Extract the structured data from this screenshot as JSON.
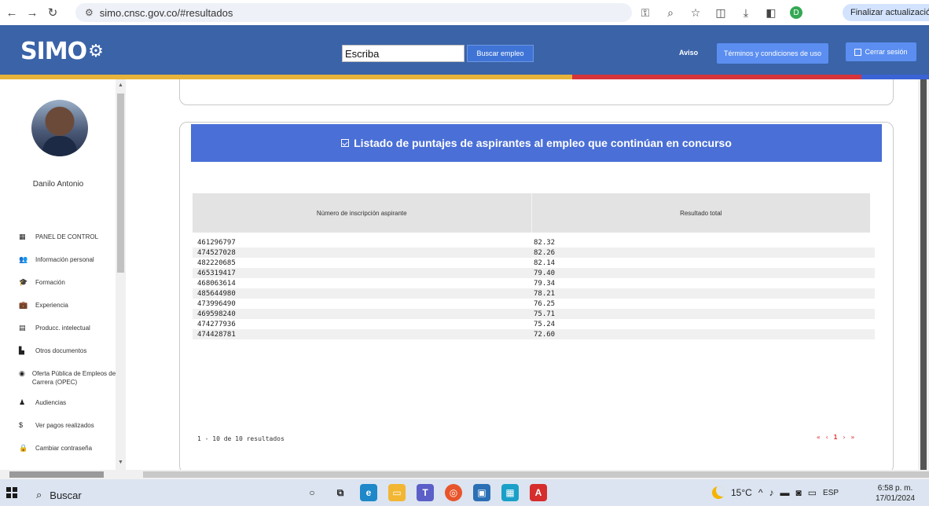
{
  "browser": {
    "url": "simo.cnsc.gov.co/#resultados",
    "profile_initial": "D",
    "update_label": "Finalizar actualización"
  },
  "header": {
    "logo": "SIMO",
    "search_value": "Escriba",
    "search_button": "Buscar empleo",
    "aviso": "Aviso",
    "terms_button": "Términos y condiciones de uso",
    "logout_button": "Cerrar sesión"
  },
  "colors": {
    "header_bg": "#3a63a8",
    "stripe_yellow": "#e8b33a",
    "stripe_red": "#d6343a",
    "stripe_blue": "#3a63d6",
    "card_header": "#4a6fd6",
    "pager": "#e03030"
  },
  "sidebar": {
    "user_name": "Danilo Antonio",
    "items": [
      {
        "icon": "dashboard-icon",
        "glyph": "▦",
        "label": "PANEL DE CONTROL"
      },
      {
        "icon": "people-icon",
        "glyph": "👥",
        "label": "Información personal"
      },
      {
        "icon": "graduation-icon",
        "glyph": "🎓",
        "label": "Formación"
      },
      {
        "icon": "briefcase-icon",
        "glyph": "💼",
        "label": "Experiencia"
      },
      {
        "icon": "book-icon",
        "glyph": "▤",
        "label": "Producc. intelectual"
      },
      {
        "icon": "document-icon",
        "glyph": "▙",
        "label": "Otros documentos"
      },
      {
        "icon": "globe-icon",
        "glyph": "◉",
        "label": "Oferta Pública de Empleos de Carrera (OPEC)"
      },
      {
        "icon": "audience-icon",
        "glyph": "♟",
        "label": "Audiencias"
      },
      {
        "icon": "dollar-icon",
        "glyph": "$",
        "label": "Ver pagos realizados"
      },
      {
        "icon": "lock-icon",
        "glyph": "🔒",
        "label": "Cambiar contraseña"
      }
    ]
  },
  "results": {
    "title": "Listado de puntajes de aspirantes al empleo que continúan en concurso",
    "columns": [
      "Número de inscripción aspirante",
      "Resultado total"
    ],
    "rows": [
      [
        "461296797",
        "82.32"
      ],
      [
        "474527028",
        "82.26"
      ],
      [
        "482220685",
        "82.14"
      ],
      [
        "465319417",
        "79.40"
      ],
      [
        "468063614",
        "79.34"
      ],
      [
        "485644980",
        "78.21"
      ],
      [
        "473996490",
        "76.25"
      ],
      [
        "469598240",
        "75.71"
      ],
      [
        "474277936",
        "75.24"
      ],
      [
        "474428781",
        "72.60"
      ]
    ],
    "count_text": "1 - 10 de 10 resultados",
    "pager": {
      "first": "«",
      "prev": "‹",
      "current": "1",
      "next": "›",
      "last": "»"
    }
  },
  "taskbar": {
    "search_label": "Buscar",
    "temperature": "15°C",
    "language": "ESP",
    "time": "6:58 p. m.",
    "date": "17/01/2024"
  }
}
